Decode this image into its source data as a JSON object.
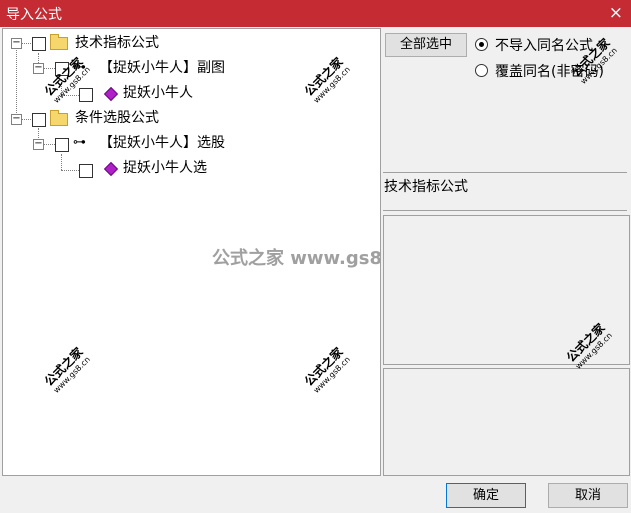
{
  "window": {
    "title": "导入公式",
    "close_icon": "×"
  },
  "tree": {
    "group1": {
      "label": "技术指标公式"
    },
    "item1": {
      "label": "【捉妖小牛人】副图"
    },
    "item1_child": {
      "label": "捉妖小牛人"
    },
    "group2": {
      "label": "条件选股公式"
    },
    "item2": {
      "label": "【捉妖小牛人】选股"
    },
    "item2_child": {
      "label": "捉妖小牛人选"
    }
  },
  "controls": {
    "select_all_label": "全部选中",
    "radio_skip_label": "不导入同名公式",
    "radio_overwrite_label": "覆盖同名(非密码)",
    "ok_label": "确定",
    "cancel_label": "取消"
  },
  "detail": {
    "formula_type": "技术指标公式"
  },
  "watermark": {
    "brand": "公式之家",
    "site": "www.gs8.cn",
    "center": "公式之家 www.gs8.cn"
  }
}
